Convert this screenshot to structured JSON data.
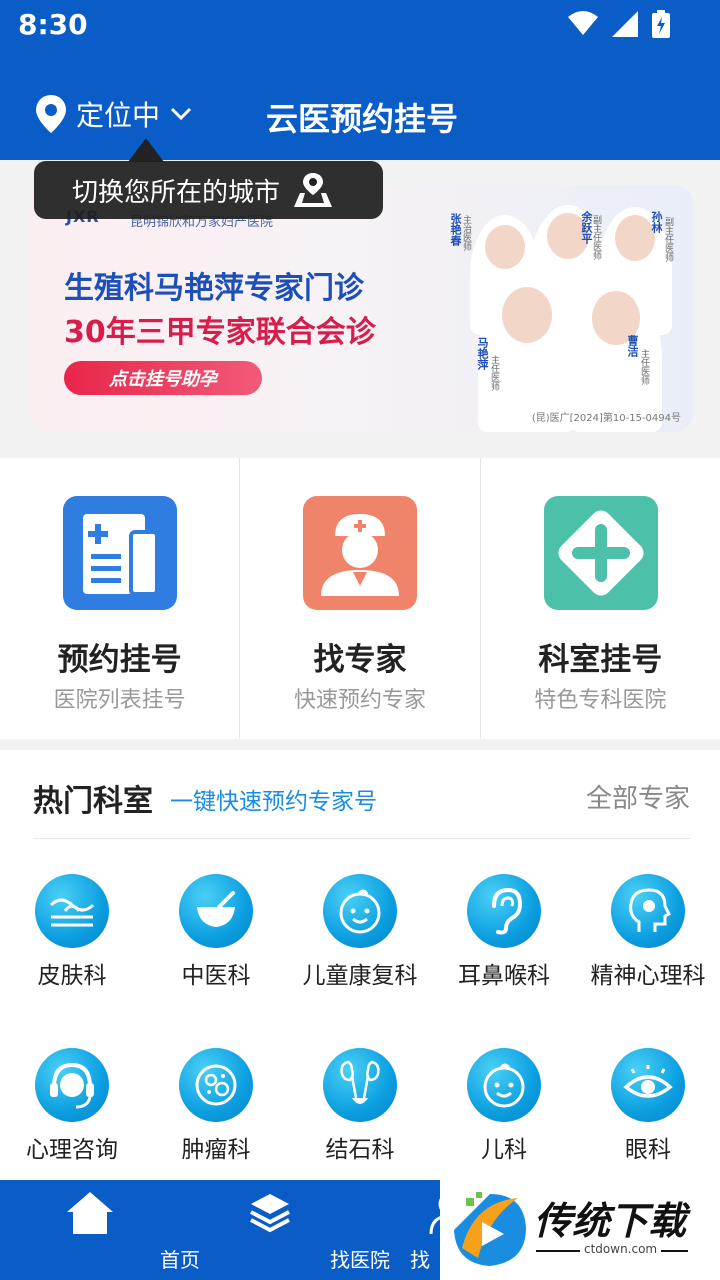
{
  "status": {
    "time": "8:30"
  },
  "header": {
    "location": "定位中",
    "title": "云医预约挂号"
  },
  "tooltip": {
    "text": "切换您所在的城市"
  },
  "banner": {
    "logo": "JXR",
    "logo_sub": "昆明锦欣和万家妇产医院",
    "headline_1": "生殖科马艳萍专家门诊",
    "headline_2": "30年三甲专家联合会诊",
    "button": "点击挂号助孕",
    "cert": "(昆)医广[2024]第10-15-0494号",
    "doctors": [
      {
        "name": "张艳春",
        "role": "主治医师"
      },
      {
        "name": "余跃平",
        "role": "副主任医师"
      },
      {
        "name": "孙林",
        "role": "副主任医师"
      },
      {
        "name": "马艳萍",
        "role": "主任医师"
      },
      {
        "name": "曹洁",
        "role": "主任医师"
      }
    ]
  },
  "services": [
    {
      "title": "预约挂号",
      "sub": "医院列表挂号",
      "color": "#2f7de0",
      "icon": "hospital-list-icon"
    },
    {
      "title": "找专家",
      "sub": "快速预约专家",
      "color": "#f0846a",
      "icon": "doctor-icon"
    },
    {
      "title": "科室挂号",
      "sub": "特色专科医院",
      "color": "#4cc0a8",
      "icon": "medical-cross-icon"
    }
  ],
  "hot": {
    "title": "热门科室",
    "sub": "一键快速预约专家号",
    "all": "全部专家",
    "departments": [
      {
        "label": "皮肤科",
        "icon": "skin-icon"
      },
      {
        "label": "中医科",
        "icon": "mortar-icon"
      },
      {
        "label": "儿童康复科",
        "icon": "child-face-icon"
      },
      {
        "label": "耳鼻喉科",
        "icon": "ear-icon"
      },
      {
        "label": "精神心理科",
        "icon": "head-brain-icon"
      },
      {
        "label": "心理咨询",
        "icon": "headset-icon"
      },
      {
        "label": "肿瘤科",
        "icon": "cell-icon"
      },
      {
        "label": "结石科",
        "icon": "kidney-icon"
      },
      {
        "label": "儿科",
        "icon": "baby-face-icon"
      },
      {
        "label": "眼科",
        "icon": "eye-icon"
      }
    ]
  },
  "bottom_nav": [
    {
      "label": "首页",
      "icon": "home-icon"
    },
    {
      "label": "找医院",
      "icon": "layers-icon"
    },
    {
      "label": "找",
      "icon": "doctor-icon"
    }
  ],
  "watermark": {
    "text": "传统下载",
    "url": "ctdown.com"
  }
}
